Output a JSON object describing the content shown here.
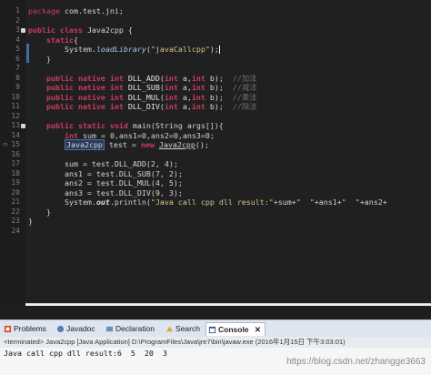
{
  "editor": {
    "lines": [
      {
        "n": "1",
        "parts": [
          {
            "t": "package ",
            "c": "kw2"
          },
          {
            "t": "com.test.jni;",
            "c": ""
          }
        ]
      },
      {
        "n": "2",
        "parts": []
      },
      {
        "n": "3",
        "parts": [
          {
            "t": "public class ",
            "c": "kw"
          },
          {
            "t": "Java2cpp {",
            "c": ""
          }
        ]
      },
      {
        "n": "4",
        "parts": [
          {
            "t": "    static",
            "c": "kw"
          },
          {
            "t": "{",
            "c": ""
          }
        ]
      },
      {
        "n": "5",
        "parts": [
          {
            "t": "        System.",
            "c": ""
          },
          {
            "t": "loadLibrary",
            "c": "method"
          },
          {
            "t": "(",
            "c": ""
          },
          {
            "t": "\"javaCallcpp\"",
            "c": "str"
          },
          {
            "t": ");",
            "c": ""
          }
        ]
      },
      {
        "n": "6",
        "parts": [
          {
            "t": "    }",
            "c": ""
          }
        ]
      },
      {
        "n": "7",
        "parts": []
      },
      {
        "n": "8",
        "parts": [
          {
            "t": "    public native int ",
            "c": "kw"
          },
          {
            "t": "DLL_ADD",
            "c": "fn"
          },
          {
            "t": "(",
            "c": ""
          },
          {
            "t": "int ",
            "c": "kw"
          },
          {
            "t": "a,",
            "c": ""
          },
          {
            "t": "int ",
            "c": "kw"
          },
          {
            "t": "b);  ",
            "c": ""
          },
          {
            "t": "//加法",
            "c": "cmt"
          }
        ]
      },
      {
        "n": "9",
        "parts": [
          {
            "t": "    public native int ",
            "c": "kw"
          },
          {
            "t": "DLL_SUB",
            "c": "fn"
          },
          {
            "t": "(",
            "c": ""
          },
          {
            "t": "int ",
            "c": "kw"
          },
          {
            "t": "a,",
            "c": ""
          },
          {
            "t": "int ",
            "c": "kw"
          },
          {
            "t": "b);  ",
            "c": ""
          },
          {
            "t": "//减法",
            "c": "cmt"
          }
        ]
      },
      {
        "n": "10",
        "parts": [
          {
            "t": "    public native int ",
            "c": "kw"
          },
          {
            "t": "DLL_MUL",
            "c": "fn"
          },
          {
            "t": "(",
            "c": ""
          },
          {
            "t": "int ",
            "c": "kw"
          },
          {
            "t": "a,",
            "c": ""
          },
          {
            "t": "int ",
            "c": "kw"
          },
          {
            "t": "b);  ",
            "c": ""
          },
          {
            "t": "//乘法",
            "c": "cmt"
          }
        ]
      },
      {
        "n": "11",
        "parts": [
          {
            "t": "    public native int ",
            "c": "kw"
          },
          {
            "t": "DLL_DIV",
            "c": "fn"
          },
          {
            "t": "(",
            "c": ""
          },
          {
            "t": "int ",
            "c": "kw"
          },
          {
            "t": "a,",
            "c": ""
          },
          {
            "t": "int ",
            "c": "kw"
          },
          {
            "t": "b);  ",
            "c": ""
          },
          {
            "t": "//除法",
            "c": "cmt"
          }
        ]
      },
      {
        "n": "12",
        "parts": []
      },
      {
        "n": "13",
        "parts": [
          {
            "t": "    public static void ",
            "c": "kw"
          },
          {
            "t": "main(String args[]){",
            "c": ""
          }
        ]
      },
      {
        "n": "14",
        "parts": [
          {
            "t": "        ",
            "c": ""
          },
          {
            "t": "int ",
            "c": "kw var-u"
          },
          {
            "t": "sum",
            "c": "var-u"
          },
          {
            "t": " = 0,ans1=0,ans2=0,ans3=0;",
            "c": ""
          }
        ]
      },
      {
        "n": "15",
        "parts": [
          {
            "t": "        ",
            "c": ""
          },
          {
            "t": "Java2cpp",
            "c": "type-box"
          },
          {
            "t": " test = ",
            "c": ""
          },
          {
            "t": "new ",
            "c": "kw"
          },
          {
            "t": "Java2cpp",
            "c": "var-u"
          },
          {
            "t": "();",
            "c": ""
          }
        ]
      },
      {
        "n": "16",
        "parts": []
      },
      {
        "n": "17",
        "parts": [
          {
            "t": "        sum = test.DLL_ADD(2, 4);",
            "c": ""
          }
        ]
      },
      {
        "n": "18",
        "parts": [
          {
            "t": "        ans1 = test.DLL_SUB(7, 2);",
            "c": ""
          }
        ]
      },
      {
        "n": "19",
        "parts": [
          {
            "t": "        ans2 = test.DLL_MUL(4, 5);",
            "c": ""
          }
        ]
      },
      {
        "n": "20",
        "parts": [
          {
            "t": "        ans3 = test.DLL_DIV(9, 3);",
            "c": ""
          }
        ]
      },
      {
        "n": "21",
        "parts": [
          {
            "t": "        System.",
            "c": ""
          },
          {
            "t": "out",
            "c": "field"
          },
          {
            "t": ".println(",
            "c": ""
          },
          {
            "t": "\"Java call cpp dll result:\"",
            "c": "str"
          },
          {
            "t": "+sum+",
            "c": ""
          },
          {
            "t": "\"  \"",
            "c": "str"
          },
          {
            "t": "+ans1+",
            "c": ""
          },
          {
            "t": "\"  \"",
            "c": "str"
          },
          {
            "t": "+ans2+",
            "c": ""
          }
        ]
      },
      {
        "n": "22",
        "parts": [
          {
            "t": "    }",
            "c": ""
          }
        ]
      },
      {
        "n": "23",
        "parts": [
          {
            "t": "}",
            "c": ""
          }
        ]
      },
      {
        "n": "24",
        "parts": []
      }
    ]
  },
  "bottom_panel": {
    "tabs": [
      {
        "label": "Problems",
        "icon": "problems-icon"
      },
      {
        "label": "Javadoc",
        "icon": "javadoc-icon"
      },
      {
        "label": "Declaration",
        "icon": "declaration-icon"
      },
      {
        "label": "Search",
        "icon": "search-icon"
      },
      {
        "label": "Console",
        "icon": "console-icon"
      }
    ],
    "close_glyph": "✕",
    "status": "<terminated> Java2cpp [Java Application] D:\\ProgramFiles\\Java\\jre7\\bin\\javaw.exe (2016年1月15日 下午3:03:01)",
    "console_output": "Java call cpp dll result:6  5  20  3"
  },
  "watermark": "https://blog.csdn.net/zhangge3663",
  "scroll_left_glyph": "<",
  "colors": {
    "keyword": "#cc3b61",
    "string": "#d6c786",
    "comment": "#6f6f6f",
    "background": "#202020"
  }
}
